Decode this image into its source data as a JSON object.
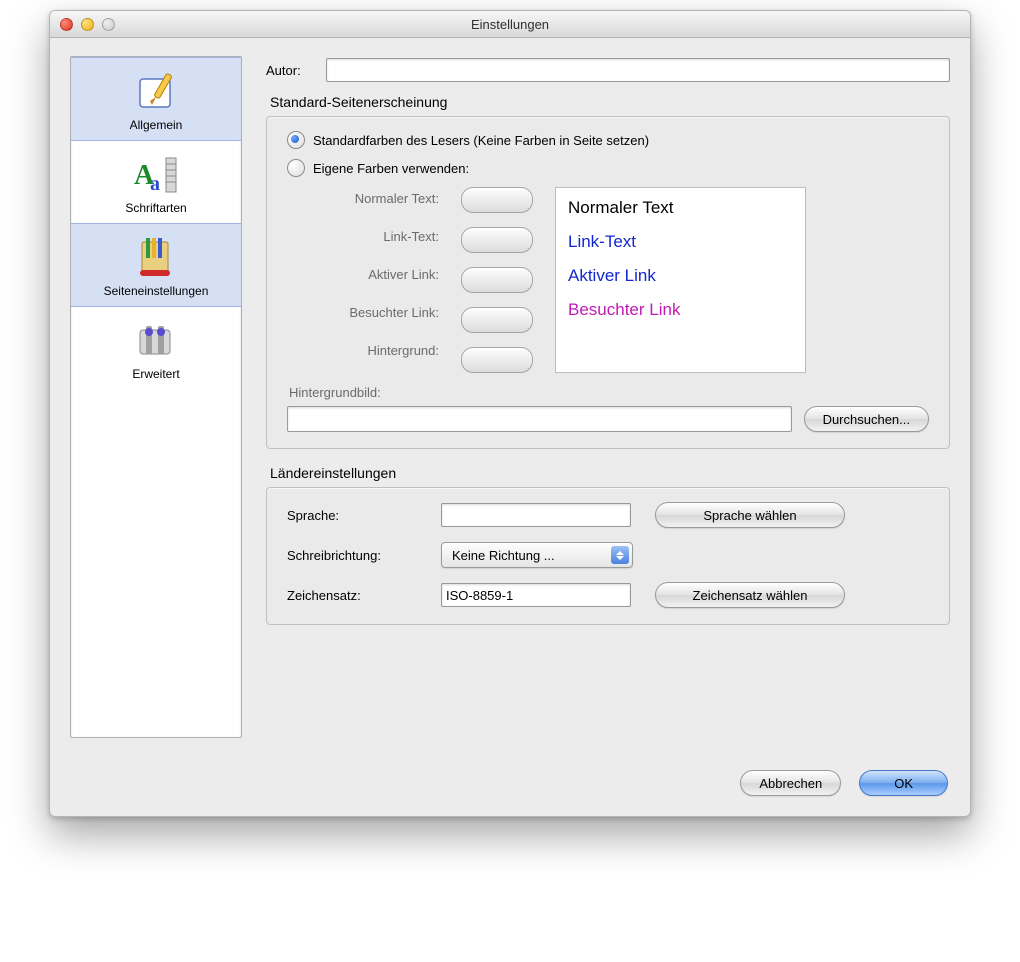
{
  "window": {
    "title": "Einstellungen"
  },
  "sidebar": {
    "items": [
      {
        "label": "Allgemein",
        "icon": "compose-icon",
        "selected": false
      },
      {
        "label": "Schriftarten",
        "icon": "fonts-icon",
        "selected": false
      },
      {
        "label": "Seiteneinstellungen",
        "icon": "page-settings-icon",
        "selected": true
      },
      {
        "label": "Erweitert",
        "icon": "advanced-icon",
        "selected": false
      }
    ]
  },
  "author": {
    "label": "Autor:",
    "value": ""
  },
  "appearance": {
    "group_title": "Standard-Seitenerscheinung",
    "radio_reader": "Standardfarben des Lesers (Keine Farben in Seite setzen)",
    "radio_custom": "Eigene Farben verwenden:",
    "labels": {
      "normal": "Normaler Text:",
      "link": "Link-Text:",
      "active": "Aktiver Link:",
      "visited": "Besuchter Link:",
      "background": "Hintergrund:"
    },
    "preview": {
      "normal": "Normaler Text",
      "link": "Link-Text",
      "active": "Aktiver Link",
      "visited": "Besuchter Link"
    },
    "colors": {
      "normal": "#000000",
      "link": "#1227ce",
      "active": "#1227ce",
      "visited": "#c01bb4"
    },
    "bg_image_label": "Hintergrundbild:",
    "bg_image_value": "",
    "browse_button": "Durchsuchen..."
  },
  "locale": {
    "group_title": "Ländereinstellungen",
    "language_label": "Sprache:",
    "language_value": "",
    "language_button": "Sprache wählen",
    "direction_label": "Schreibrichtung:",
    "direction_value": "Keine Richtung ...",
    "charset_label": "Zeichensatz:",
    "charset_value": "ISO-8859-1",
    "charset_button": "Zeichensatz wählen"
  },
  "footer": {
    "cancel": "Abbrechen",
    "ok": "OK"
  }
}
